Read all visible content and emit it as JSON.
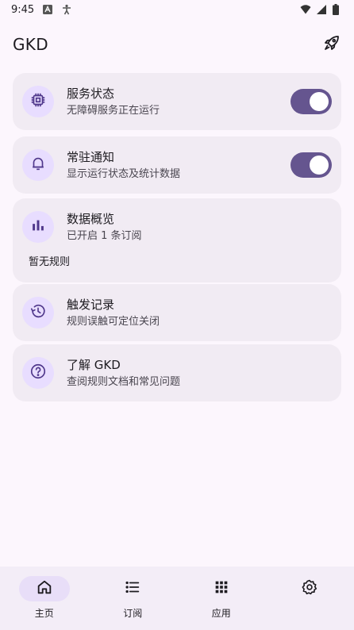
{
  "status_bar": {
    "time": "9:45"
  },
  "app": {
    "title": "GKD"
  },
  "cards": {
    "service": {
      "title": "服务状态",
      "subtitle": "无障碍服务正在运行",
      "switch_on": true
    },
    "notification": {
      "title": "常驻通知",
      "subtitle": "显示运行状态及统计数据",
      "switch_on": true
    },
    "overview": {
      "title": "数据概览",
      "subtitle": "已开启 1 条订阅",
      "extra": "暂无规则"
    },
    "trigger_log": {
      "title": "触发记录",
      "subtitle": "规则误触可定位关闭"
    },
    "about": {
      "title": "了解 GKD",
      "subtitle": "查阅规则文档和常见问题"
    }
  },
  "bottom_nav": {
    "home": "主页",
    "subscriptions": "订阅",
    "apps": "应用",
    "settings": ""
  },
  "colors": {
    "accent": "#65558f",
    "icon_bg": "#e8ddff",
    "card_bg": "#f1ebf3",
    "page_bg": "#fcf6fd"
  },
  "icons": {
    "top_action": "rocket-icon",
    "service": "chip-icon",
    "notification": "bell-icon",
    "overview": "bar-chart-icon",
    "trigger_log": "history-icon",
    "about": "help-circle-icon"
  }
}
